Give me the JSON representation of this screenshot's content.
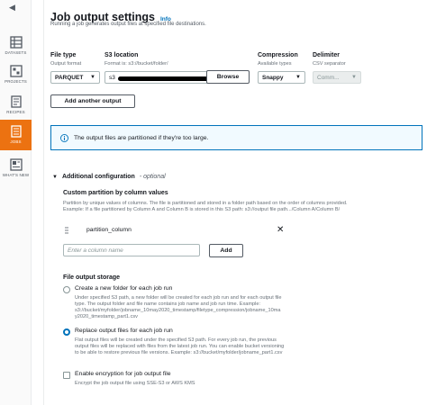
{
  "nav": {
    "items": [
      {
        "label": "DATASETS",
        "icon": "datasets-icon"
      },
      {
        "label": "PROJECTS",
        "icon": "projects-icon"
      },
      {
        "label": "RECIPES",
        "icon": "recipes-icon"
      },
      {
        "label": "JOBS",
        "icon": "jobs-icon",
        "active": true
      },
      {
        "label": "WHAT'S NEW",
        "icon": "whats-new-icon"
      }
    ]
  },
  "header": {
    "title": "Job output settings",
    "info": "Info",
    "subtitle": "Running a job generates output files at specified file destinations."
  },
  "output": {
    "file_type_label": "File type",
    "file_type_desc": "Output format",
    "file_type_value": "PARQUET",
    "s3_label": "S3 location",
    "s3_desc": "Format is: s3://bucket/folder/",
    "s3_value": "s3",
    "browse_label": "Browse",
    "compression_label": "Compression",
    "compression_desc": "Available types",
    "compression_value": "Snappy",
    "delimiter_label": "Delimiter",
    "delimiter_desc": "CSV separator",
    "delimiter_value": "Comm...",
    "add_output_label": "Add another output"
  },
  "alert": {
    "message": "The output files are partitioned if they're too large."
  },
  "additional": {
    "title": "Additional configuration",
    "optional": "- optional",
    "partition_title": "Custom partition by column values",
    "partition_desc_1": "Partition by unique values of columns. The file is partitioned and stored in a folder path based on the order of columns provided.",
    "partition_desc_2": "Example: If a file partitioned by Column A and Column B is stored in this S3 path: s3://output file path.../Column A/Column B/",
    "partition_column": "partition_column",
    "column_placeholder": "Enter a column name",
    "add_label": "Add",
    "storage_title": "File output storage",
    "opt_new_label": "Create a new folder for each job run",
    "opt_new_desc": [
      "Under specified S3 path, a new folder will be created for each job run and for each output file",
      "type. The output folder and file name contains job name and job run time. Example:",
      "s3://bucket/myfolder/jobname_10may2020_timestamp/filetype_compression/jobname_10ma",
      "y2020_timestamp_part1.csv"
    ],
    "opt_replace_label": "Replace output files for each job run",
    "opt_replace_desc": [
      "Flat output files will be created under the specified S3 path. For every job run, the previous",
      "output files will be replaced with files from the latest job run. You can enable bucket versioning",
      "to be able to restore previous file versions. Example: s3://bucket/myfolder/jobname_part1.csv"
    ],
    "encrypt_label": "Enable encryption for job output file",
    "encrypt_desc": "Encrypt the job output file using SSE-S3 or AWS KMS"
  },
  "colors": {
    "accent": "#ec7211",
    "link": "#0073bb",
    "alert_bg": "#f1faff"
  }
}
